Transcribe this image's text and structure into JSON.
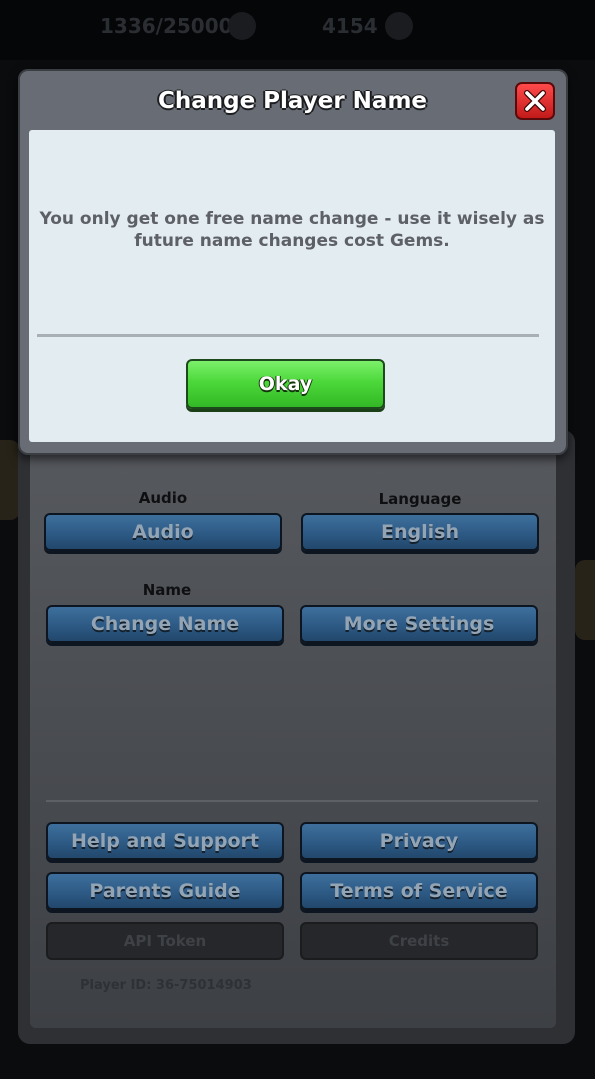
{
  "topbar": {
    "progress_text": "1336/25000",
    "gem_count": "4154"
  },
  "modal": {
    "title": "Change Player Name",
    "message": "You only get one free name change - use it wisely as future name changes cost Gems.",
    "okay_label": "Okay",
    "close_icon": "close-x-icon"
  },
  "settings": {
    "audio_label": "Audio",
    "audio_button": "Audio",
    "language_label": "Language",
    "language_button": "English",
    "name_label": "Name",
    "change_name_button": "Change Name",
    "more_settings_button": "More Settings",
    "help_button": "Help and Support",
    "privacy_button": "Privacy",
    "parents_guide_button": "Parents Guide",
    "terms_button": "Terms of Service",
    "api_token_button": "API Token",
    "credits_button": "Credits",
    "player_id": "Player ID: 36-75014903"
  },
  "colors": {
    "okay_green": "#4cd83a",
    "close_red": "#e32a2a",
    "settings_blue": "#2d5a85",
    "modal_bg": "#e3ecf0"
  }
}
